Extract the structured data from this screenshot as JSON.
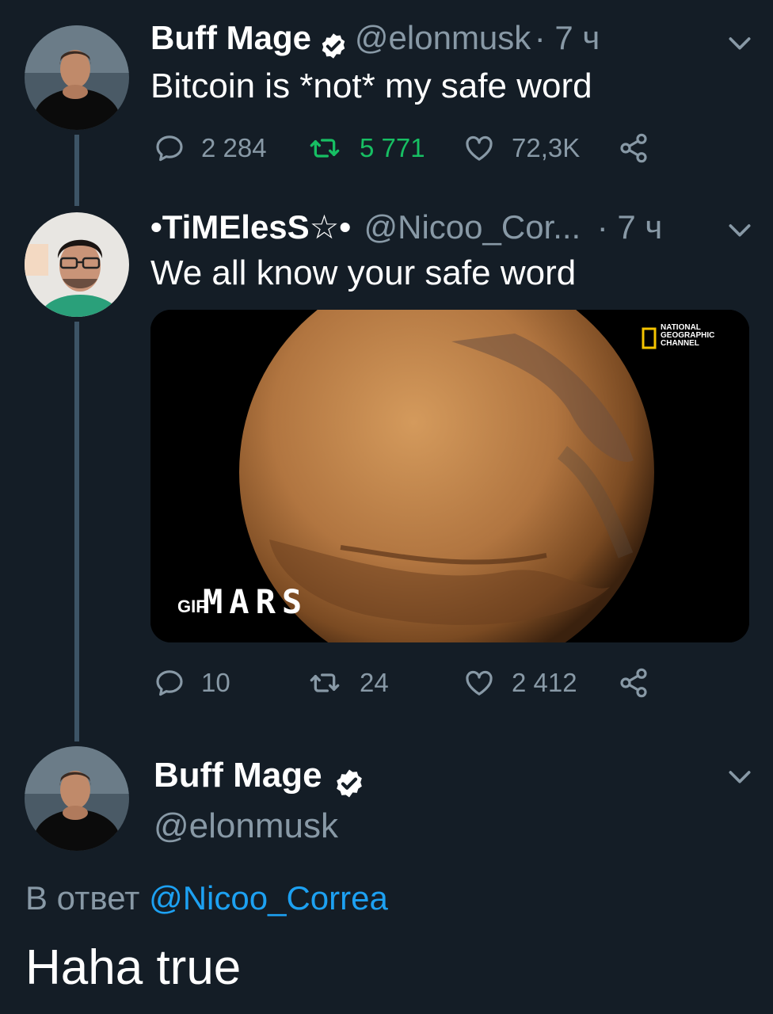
{
  "tweet1": {
    "name": "Buff Mage",
    "handle": "@elonmusk",
    "time": "· 7 ч",
    "text": "Bitcoin is *not* my safe word",
    "replies": "2 284",
    "retweets": "5 771",
    "likes": "72,3K"
  },
  "tweet2": {
    "name": "•TiMElesS☆•",
    "handle": "@Nicoo_Cor...",
    "time": "· 7 ч",
    "text": "We all know your safe word",
    "media": {
      "badge": "GIF",
      "caption": "MARS",
      "watermark": [
        "NATIONAL",
        "GEOGRAPHIC",
        "CHANNEL"
      ]
    },
    "replies": "10",
    "retweets": "24",
    "likes": "2 412"
  },
  "tweet3": {
    "name": "Buff Mage",
    "handle": "@elonmusk",
    "reply_prefix": "В ответ",
    "reply_to": "@Nicoo_Correa",
    "text": "Haha true"
  },
  "colors": {
    "background": "#141d26",
    "secondary_text": "#8899a6",
    "link": "#1da1f2",
    "retweet_active": "#17bf63",
    "thread_line": "#3d5466"
  },
  "icons": [
    "verified-badge-icon",
    "chevron-down-icon",
    "reply-icon",
    "retweet-icon",
    "like-icon",
    "share-icon"
  ]
}
